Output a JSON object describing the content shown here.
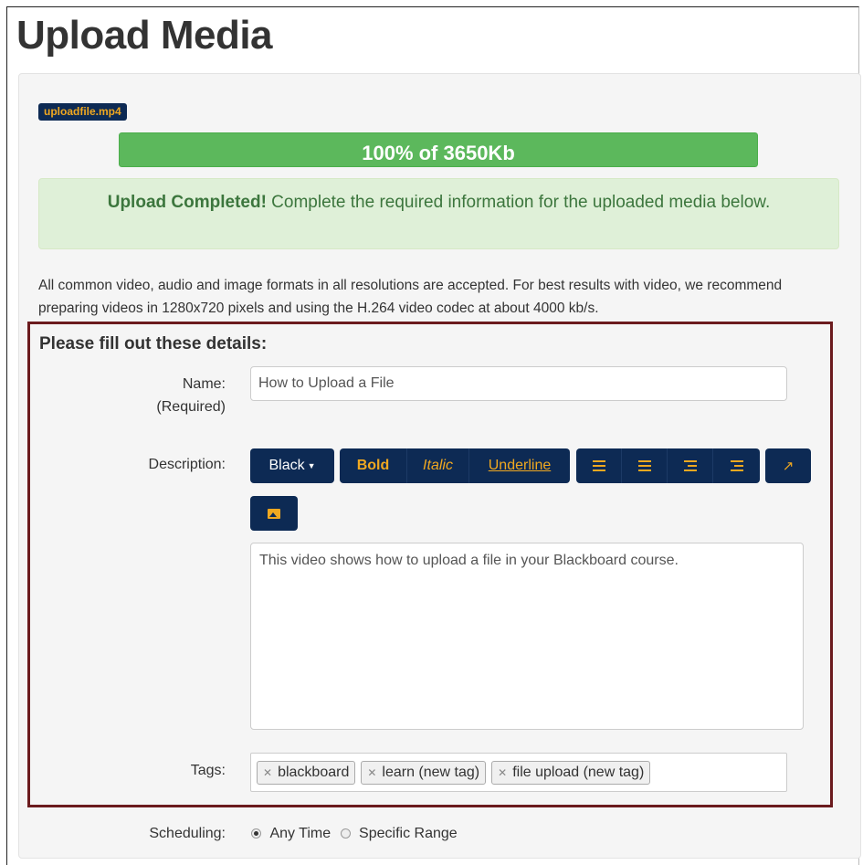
{
  "page": {
    "title": "Upload Media"
  },
  "upload": {
    "filename": "uploadfile.mp4",
    "progress_percent": 100,
    "progress_text": "100% of 3650Kb"
  },
  "alert": {
    "strong": "Upload Completed!",
    "message": " Complete the required information for the uploaded media below."
  },
  "info_text": "All common video, audio and image formats in all resolutions are accepted. For best results with video, we recommend preparing videos in 1280x720 pixels and using the H.264 video codec at about 4000 kb/s.",
  "form": {
    "title": "Please fill out these details:",
    "name_label": "Name:",
    "name_required": "(Required)",
    "name_value": "How to Upload a File",
    "description_label": "Description:",
    "description_value": "This video shows how to upload a file in your Blackboard course.",
    "tags_label": "Tags:",
    "scheduling_label": "Scheduling:"
  },
  "toolbar": {
    "color": "Black",
    "bold": "Bold",
    "italic": "Italic",
    "underline": "Underline",
    "icons": [
      "unordered-list-icon",
      "ordered-list-icon",
      "outdent-icon",
      "indent-icon",
      "share-icon",
      "image-icon"
    ]
  },
  "tags": [
    "blackboard",
    "learn (new tag)",
    "file upload (new tag)"
  ],
  "scheduling": {
    "options": [
      "Any Time",
      "Specific Range"
    ],
    "selected": "Any Time"
  },
  "colors": {
    "navy": "#0d2a54",
    "gold": "#f0a820",
    "green": "#5cb85c",
    "alert_bg": "#dff0d8",
    "alert_text": "#3c763d",
    "border_red": "#6b1b1e"
  }
}
